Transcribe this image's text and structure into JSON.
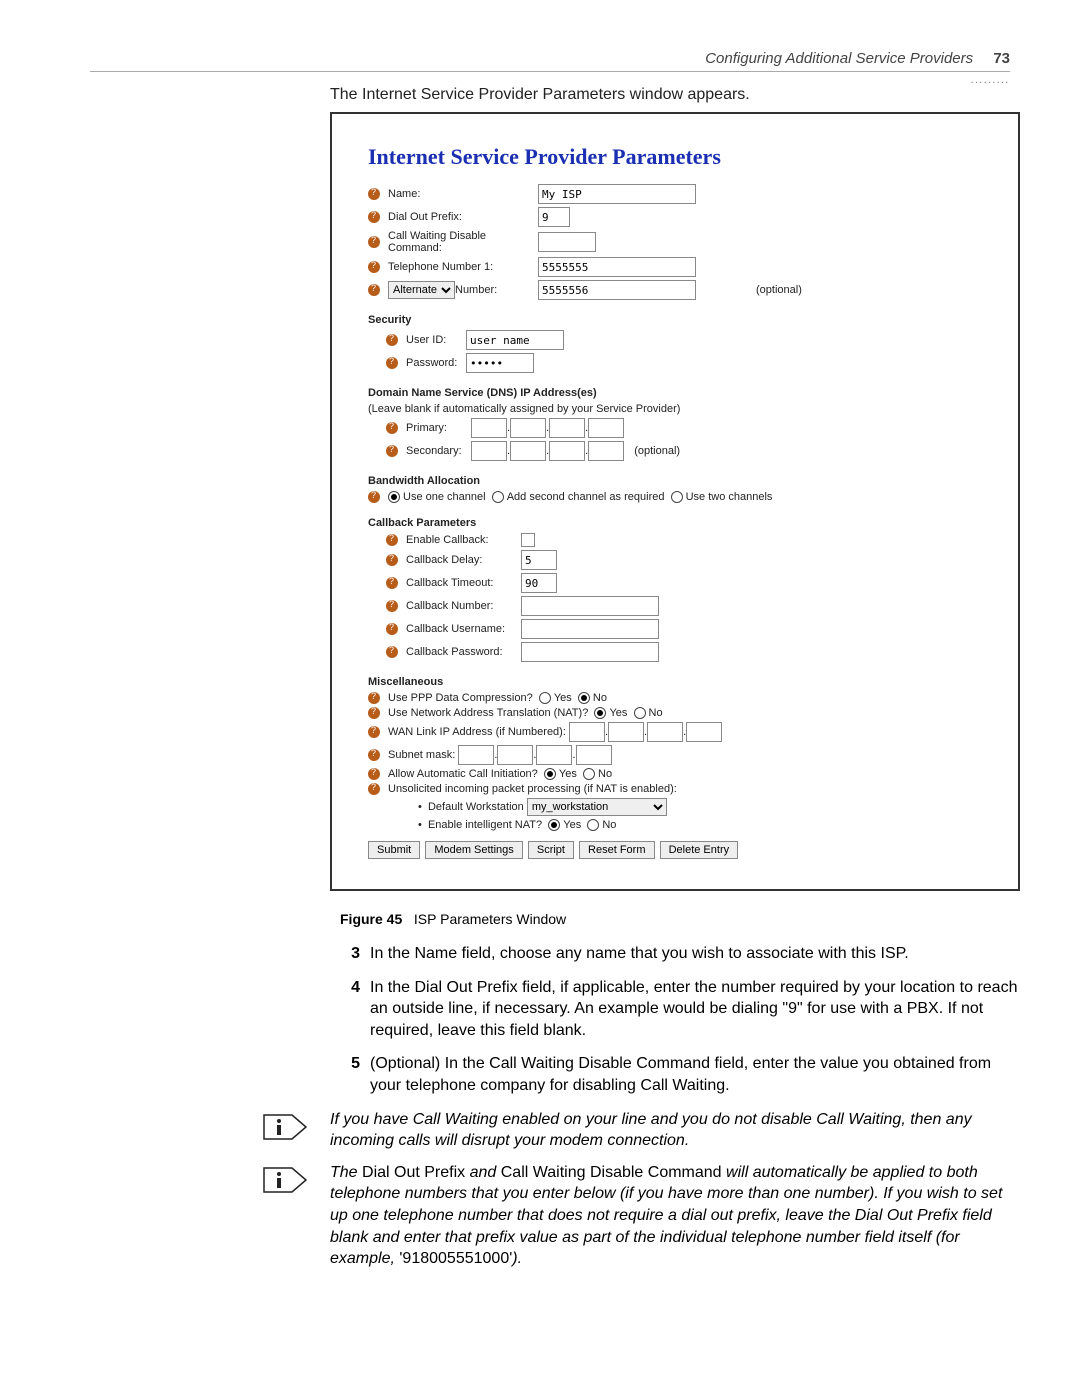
{
  "header": {
    "section": "Configuring Additional Service Providers",
    "page": "73"
  },
  "intro": "The Internet Service Provider Parameters window appears.",
  "screenshot": {
    "title": "Internet Service Provider Parameters",
    "fields": {
      "name_label": "Name:",
      "name_value": "My ISP",
      "dial_prefix_label": "Dial Out Prefix:",
      "dial_prefix_value": "9",
      "call_waiting_label": "Call Waiting Disable Command:",
      "tel1_label": "Telephone Number 1:",
      "tel1_value": "5555555",
      "alternate": "Alternate",
      "number_label": " Number:",
      "alt_value": "5555556",
      "optional": "(optional)"
    },
    "security": {
      "heading": "Security",
      "user_id_label": "User ID:",
      "user_id_value": "user name",
      "password_label": "Password:",
      "password_value": "•••••"
    },
    "dns": {
      "heading": "Domain Name Service (DNS) IP Address(es)",
      "note": "(Leave blank if automatically assigned by your Service Provider)",
      "primary_label": "Primary:",
      "secondary_label": "Secondary:",
      "optional": "(optional)"
    },
    "bandwidth": {
      "heading": "Bandwidth Allocation",
      "opt1": "Use one channel",
      "opt2": "Add second channel as required",
      "opt3": "Use two channels"
    },
    "callback": {
      "heading": "Callback Parameters",
      "enable_label": "Enable Callback:",
      "delay_label": "Callback Delay:",
      "delay_value": "5",
      "timeout_label": "Callback Timeout:",
      "timeout_value": "90",
      "number_label": "Callback Number:",
      "username_label": "Callback Username:",
      "password_label": "Callback Password:"
    },
    "misc": {
      "heading": "Miscellaneous",
      "ppp": "Use PPP Data Compression?",
      "nat": "Use Network Address Translation (NAT)?",
      "wan": "WAN Link IP Address (if Numbered):",
      "subnet": "Subnet mask:",
      "auto_call": "Allow Automatic Call Initiation?",
      "unsolicited": "Unsolicited incoming packet processing (if NAT is enabled):",
      "default_ws_label": "Default Workstation",
      "default_ws_value": "my_workstation",
      "intel_nat": "Enable intelligent NAT?",
      "yes": "Yes",
      "no": "No"
    },
    "buttons": {
      "submit": "Submit",
      "modem": "Modem Settings",
      "script": "Script",
      "reset": "Reset Form",
      "delete": "Delete Entry"
    }
  },
  "figure": {
    "label": "Figure 45",
    "caption": "ISP Parameters Window"
  },
  "instructions": {
    "i3": "In the Name field, choose any name that you wish to associate with this ISP.",
    "i4": "In the Dial Out Prefix field, if applicable, enter the number required by your location to reach an outside line, if necessary. An example would be dialing \"9\" for use with a PBX. If not required, leave this field blank.",
    "i5": "(Optional) In the Call Waiting Disable Command field, enter the value you obtained from your telephone company for disabling Call Waiting."
  },
  "notes": {
    "n1": "If you have Call Waiting enabled on your line and you do not disable Call Waiting, then any incoming calls will disrupt your modem connection.",
    "n2_parts": {
      "p1": "The ",
      "p2": "Dial Out Prefix",
      "p3": " and ",
      "p4": "Call Waiting Disable Command",
      "p5": " will automatically be applied to both telephone numbers that you enter below (if you have more than one number). If you wish to set up one telephone number that does not require a dial out prefix, leave the Dial Out Prefix field blank and enter that prefix value as part of the individual telephone number field itself (for example, ",
      "p6": "'918005551000'",
      "p7": ")."
    }
  }
}
